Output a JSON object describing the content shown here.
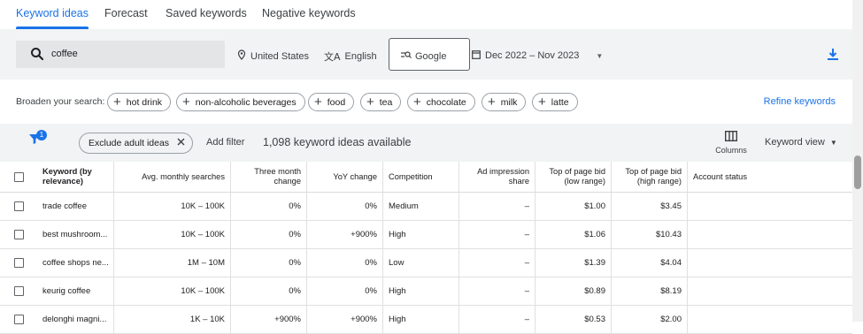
{
  "tabs": [
    "Keyword ideas",
    "Forecast",
    "Saved keywords",
    "Negative keywords"
  ],
  "search": {
    "value": "coffee"
  },
  "location": "United States",
  "language": "English",
  "network": "Google",
  "date_range": "Dec 2022 – Nov 2023",
  "broaden": {
    "label": "Broaden your search:",
    "chips": [
      "hot drink",
      "non-alcoholic beverages",
      "food",
      "tea",
      "chocolate",
      "milk",
      "latte"
    ],
    "refine": "Refine keywords"
  },
  "filter": {
    "badge": "1",
    "chip": "Exclude adult ideas",
    "add": "Add filter",
    "count": "1,098 keyword ideas available",
    "columns": "Columns",
    "view": "Keyword view"
  },
  "table": {
    "headers": [
      "Keyword (by relevance)",
      "Avg. monthly searches",
      "Three month change",
      "YoY change",
      "Competition",
      "Ad impression share",
      "Top of page bid (low range)",
      "Top of page bid (high range)",
      "Account status"
    ],
    "rows": [
      [
        "trade coffee",
        "10K – 100K",
        "0%",
        "0%",
        "Medium",
        "–",
        "$1.00",
        "$3.45",
        ""
      ],
      [
        "best mushroom...",
        "10K – 100K",
        "0%",
        "+900%",
        "High",
        "–",
        "$1.06",
        "$10.43",
        ""
      ],
      [
        "coffee shops ne...",
        "1M – 10M",
        "0%",
        "0%",
        "Low",
        "–",
        "$1.39",
        "$4.04",
        ""
      ],
      [
        "keurig coffee",
        "10K – 100K",
        "0%",
        "0%",
        "High",
        "–",
        "$0.89",
        "$8.19",
        ""
      ],
      [
        "delonghi magni...",
        "1K – 10K",
        "+900%",
        "+900%",
        "High",
        "–",
        "$0.53",
        "$2.00",
        ""
      ]
    ]
  },
  "colors": {
    "accent": "#1a73e8",
    "panel": "#f1f3f4"
  }
}
